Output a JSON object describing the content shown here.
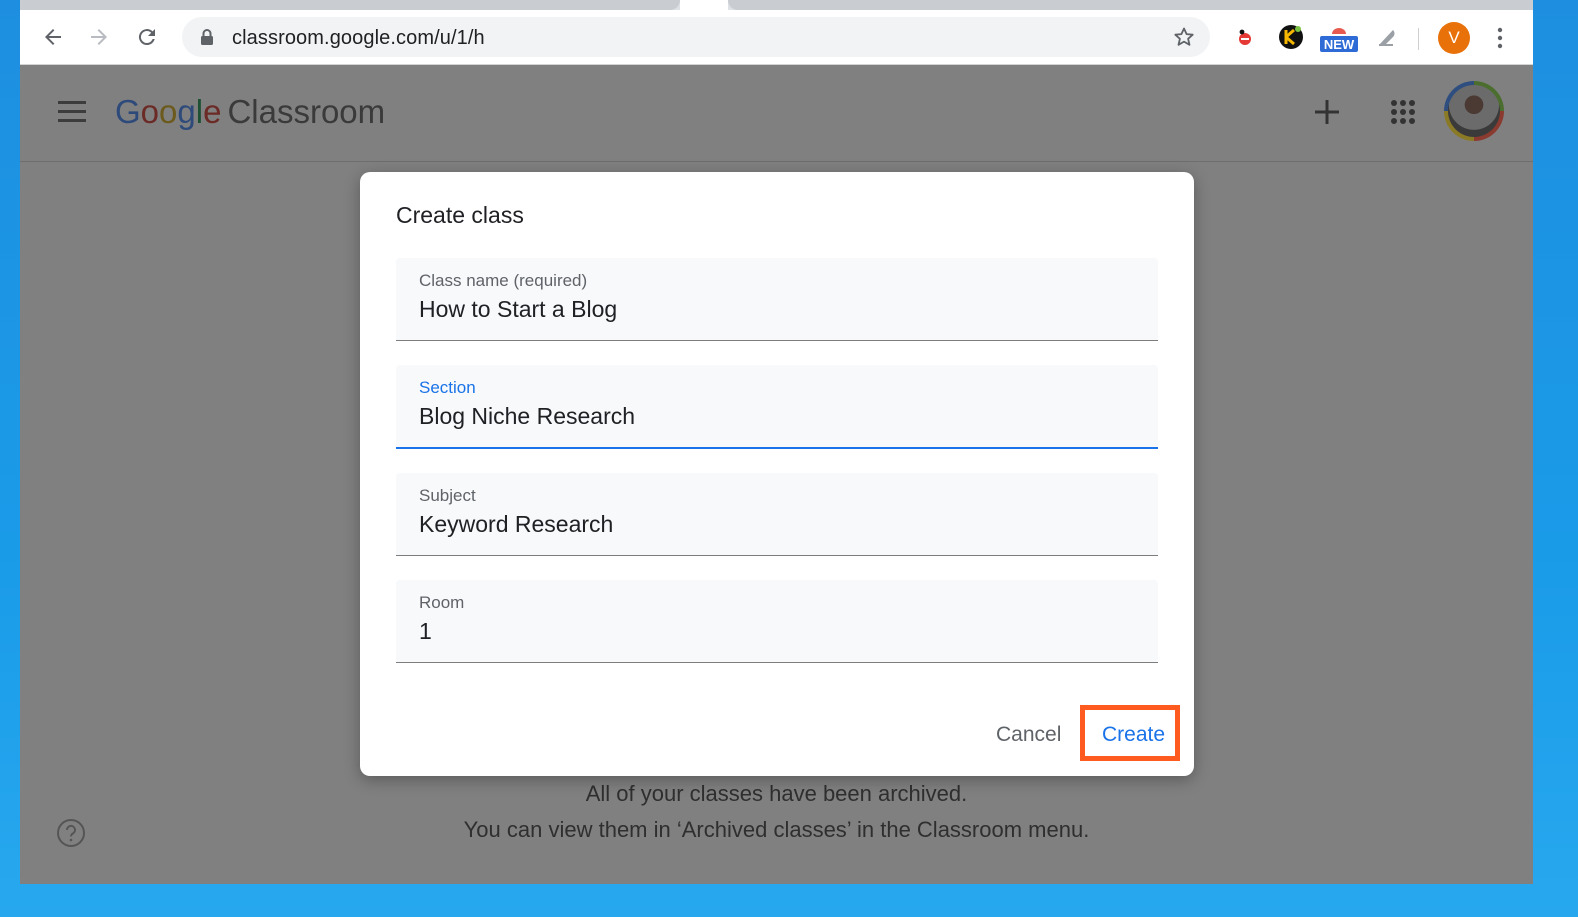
{
  "browser": {
    "url": "classroom.google.com/u/1/h",
    "extensions": {
      "new_badge": "NEW"
    },
    "profile_initial": "V"
  },
  "app": {
    "brand_google_letters": [
      "G",
      "o",
      "o",
      "g",
      "l",
      "e"
    ],
    "brand_product": "Classroom",
    "colors": {
      "accent": "#1a73e8",
      "highlight": "#ff5a1f"
    }
  },
  "dialog": {
    "title": "Create class",
    "fields": [
      {
        "label": "Class name (required)",
        "value": "How to Start a Blog"
      },
      {
        "label": "Section",
        "value": "Blog Niche Research"
      },
      {
        "label": "Subject",
        "value": "Keyword Research"
      },
      {
        "label": "Room",
        "value": "1"
      }
    ],
    "cancel_label": "Cancel",
    "create_label": "Create"
  },
  "background_message": {
    "line1": "All of your classes have been archived.",
    "line2": "You can view them in ‘Archived classes’ in the Classroom menu."
  }
}
